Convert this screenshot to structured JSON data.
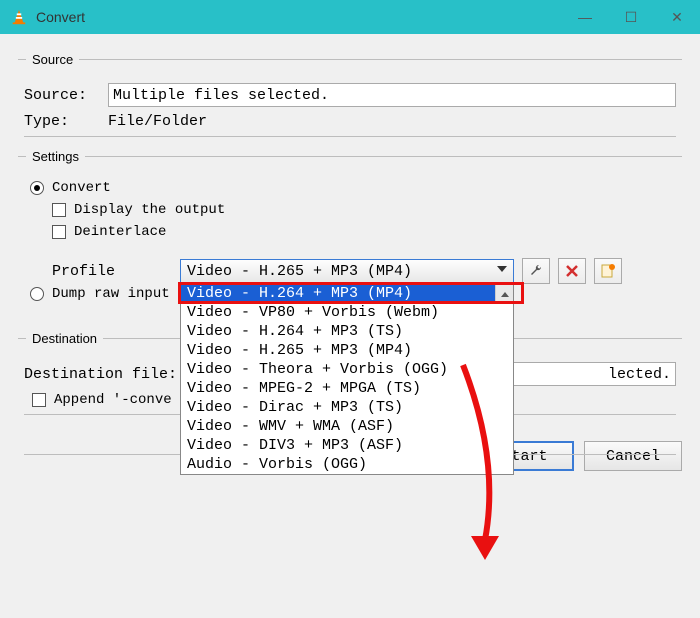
{
  "window": {
    "title": "Convert",
    "controls": {
      "min": "—",
      "max": "☐",
      "close": "✕"
    }
  },
  "source": {
    "legend": "Source",
    "source_label": "Source:",
    "source_value": "Multiple files selected.",
    "type_label": "Type:",
    "type_value": "File/Folder"
  },
  "settings": {
    "legend": "Settings",
    "convert_label": "Convert",
    "display_label": "Display the output",
    "deinterlace_label": "Deinterlace",
    "profile_label": "Profile",
    "profile_selected": "Video - H.265 + MP3 (MP4)",
    "profile_options": [
      "Video - H.264 + MP3 (MP4)",
      "Video - VP80 + Vorbis (Webm)",
      "Video - H.264 + MP3 (TS)",
      "Video - H.265 + MP3 (MP4)",
      "Video - Theora + Vorbis (OGG)",
      "Video - MPEG-2 + MPGA (TS)",
      "Video - Dirac + MP3 (TS)",
      "Video - WMV + WMA (ASF)",
      "Video - DIV3 + MP3 (ASF)",
      "Audio - Vorbis (OGG)"
    ],
    "dump_label": "Dump raw input"
  },
  "destination": {
    "legend": "Destination",
    "file_label": "Destination file:",
    "file_suffix": "lected.",
    "append_label": "Append '-conve"
  },
  "buttons": {
    "start": "Start",
    "cancel": "Cancel"
  },
  "icons": {
    "wrench": "wrench-icon",
    "delete": "delete-icon",
    "notepad": "new-profile-icon"
  },
  "colors": {
    "titlebar": "#28c0c8",
    "highlight": "#1a5fd4",
    "annotation_red": "#e91010",
    "button_border_primary": "#3a7bd5"
  }
}
